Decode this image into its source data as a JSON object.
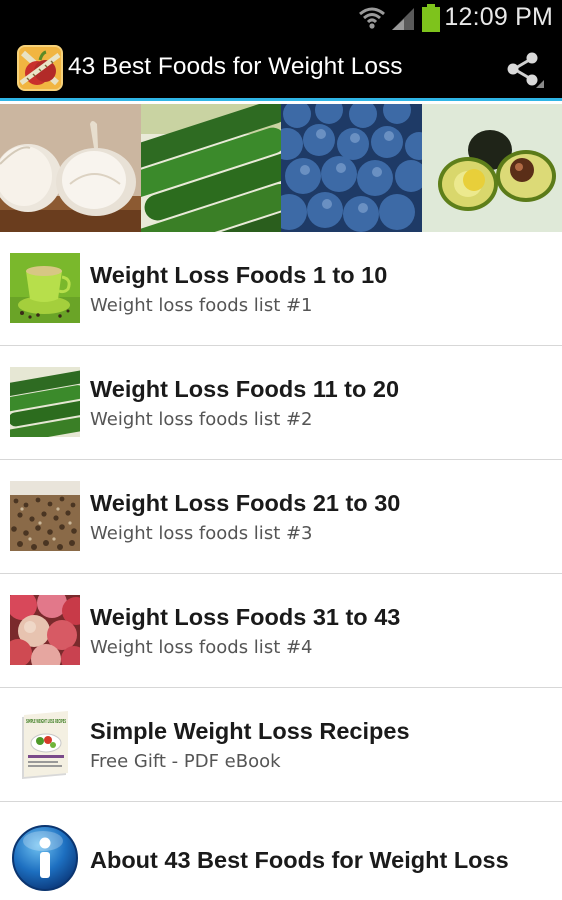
{
  "status_bar": {
    "time": "12:09 PM",
    "icons": [
      "wifi-icon",
      "signal-icon",
      "battery-icon"
    ],
    "battery_color": "#7ec31c"
  },
  "action_bar": {
    "title": "43 Best Foods for Weight Loss",
    "app_icon": "apple-tape-measure-icon",
    "share_icon": "share-icon",
    "accent_color": "#2fb5e6"
  },
  "banner": {
    "images": [
      "garlic",
      "cucumbers",
      "blueberries",
      "avocado"
    ]
  },
  "menu": {
    "items": [
      {
        "title": "Weight Loss Foods 1 to 10",
        "subtitle": "Weight loss foods list #1",
        "thumbnail": "green-tea"
      },
      {
        "title": "Weight Loss Foods 11 to 20",
        "subtitle": "Weight loss foods list #2",
        "thumbnail": "cucumbers"
      },
      {
        "title": "Weight Loss Foods 21 to 30",
        "subtitle": "Weight loss foods list #3",
        "thumbnail": "seeds"
      },
      {
        "title": "Weight Loss Foods 31 to 43",
        "subtitle": "Weight loss foods list #4",
        "thumbnail": "peaches"
      },
      {
        "title": "Simple Weight Loss Recipes",
        "subtitle": "Free Gift - PDF eBook",
        "thumbnail": "ebook-cover"
      },
      {
        "title": "About 43 Best Foods for Weight Loss",
        "subtitle": "",
        "thumbnail": "info-icon"
      }
    ]
  },
  "ebook_cover": {
    "title": "SIMPLE WEIGHT LOSS RECIPES"
  }
}
